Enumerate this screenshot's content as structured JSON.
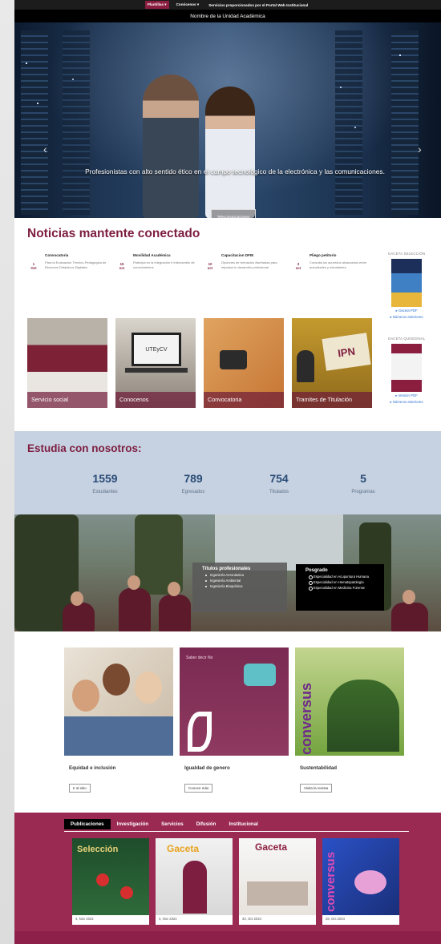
{
  "nav": {
    "items": [
      "Plantillas ▾",
      "Conócenos ▾",
      "Servicios proporcionados por el Portal Web Institucional"
    ],
    "unit_name": "Nombre de la Unidad Académica"
  },
  "hero": {
    "caption": "Profesionistas con alto sentido ético en el campo tecnológico de la electrónica y las comunicaciones.",
    "button": "Telecomunicaciones"
  },
  "news": {
    "title": "Noticias mantente conectado",
    "items": [
      {
        "day": "1",
        "month": "Oct",
        "title": "Convocatoria",
        "text": "Para la Evaluación Técnico-Pedagógica de Recursos Didácticos Digitales"
      },
      {
        "day": "15",
        "month": "oct",
        "title": "Movilidad Académica",
        "text": "Participa en la integración e intercambio de conocimientos"
      },
      {
        "day": "10",
        "month": "oct",
        "title": "Capacitacion DFIE",
        "text": "Opciones de formación diseñadas para impulsar tu desarrollo profesional"
      },
      {
        "day": "3",
        "month": "oct",
        "title": "Pliego petitorio",
        "text": "Consulta los acuerdos alcanzados entre autoridades y estudiantes"
      }
    ],
    "cards": [
      "Servicio social",
      "Conocenos",
      "Convocatoria",
      "Tramites de Titulación"
    ],
    "laptop_text": "UTEyCV",
    "ipn_text": "IPN"
  },
  "gaceta": {
    "seleccion_title": "GACETA SELECCIÓN",
    "seleccion_link1": "▸ Gaceta PDF",
    "seleccion_link2": "▸ Números anteriores",
    "quincenal_title": "GACETA QUINCENAL",
    "quincenal_link1": "▸ Versión PDF",
    "quincenal_link2": "▸ Números anteriores"
  },
  "stats": {
    "title": "Estudia con nosotros:",
    "items": [
      {
        "n": "1559",
        "l": "Estudiantes"
      },
      {
        "n": "789",
        "l": "Egresados"
      },
      {
        "n": "754",
        "l": "Titulados"
      },
      {
        "n": "5",
        "l": "Programas"
      }
    ]
  },
  "programs": {
    "tp_title": "Títulos profesionales",
    "tp": [
      "Ingeniería Aeronáutica",
      "Ingeniería Ambiental",
      "Ingeniería Bioquímica"
    ],
    "pg_title": "Posgrado",
    "pg": [
      "Especialidad en Acupuntura Humana",
      "Especialidad en Hematopatología",
      "Especialidad en Medicina Forense"
    ]
  },
  "promos": [
    {
      "name": "Equidad e inclusión",
      "btn": "Ir al sitio"
    },
    {
      "name": "Igualdad de genero",
      "btn": "Conoce más",
      "overlay": "Saber decir No"
    },
    {
      "name": "Sustentabilidad",
      "btn": "Visita la revista",
      "overlay": "conversus"
    }
  ],
  "publications": {
    "tabs": [
      "Publicaciones",
      "Investigación",
      "Servicios",
      "Difusión",
      "Institucional"
    ],
    "items": [
      {
        "date": "4, Nov 2024",
        "title": "Selección"
      },
      {
        "date": "4, Nov 2024",
        "title": "Gaceta"
      },
      {
        "date": "30, Oct 2024",
        "title": "Gaceta"
      },
      {
        "date": "28, Oct 2024",
        "title": "conversus"
      }
    ]
  }
}
